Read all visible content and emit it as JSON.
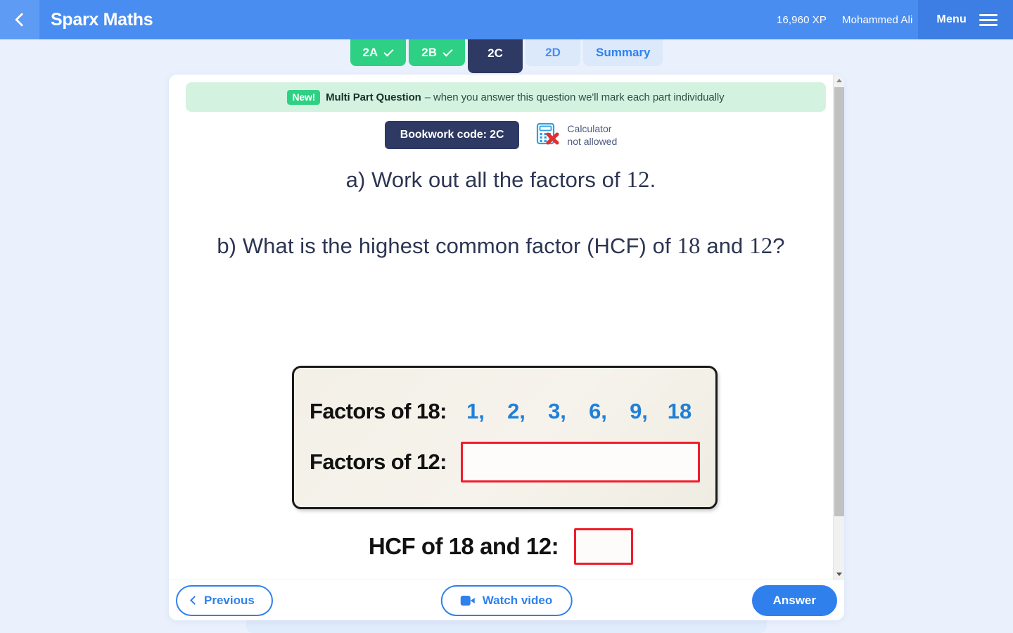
{
  "header": {
    "back_icon": "chevron-left-icon",
    "brand": "Sparx Maths",
    "xp": "16,960 XP",
    "user": "Mohammed Ali",
    "menu_label": "Menu",
    "menu_icon": "hamburger-icon",
    "bg_color": "#4a8df0",
    "menu_bg_color": "#3d7ee4"
  },
  "tabs": [
    {
      "label": "2A",
      "state": "done",
      "tick": true
    },
    {
      "label": "2B",
      "state": "done",
      "tick": true
    },
    {
      "label": "2C",
      "state": "active",
      "tick": false
    },
    {
      "label": "2D",
      "state": "upcoming",
      "tick": false
    },
    {
      "label": "Summary",
      "state": "summary",
      "tick": false
    }
  ],
  "banner": {
    "badge": "New!",
    "title": "Multi Part Question",
    "text": "– when you answer this question we'll mark each part individually",
    "bg_color": "#d4f2e0",
    "badge_color": "#2ed183"
  },
  "meta": {
    "bookwork_code": "Bookwork code: 2C",
    "calculator_icon": "calculator-not-allowed-icon",
    "calculator_line1": "Calculator",
    "calculator_line2": "not allowed"
  },
  "question": {
    "part_a_prefix": "a) Work out all the factors of ",
    "part_a_number": "12",
    "part_a_suffix": ".",
    "part_b_prefix": "b) What is the highest common factor (HCF) of ",
    "part_b_number1": "18",
    "part_b_middle": " and ",
    "part_b_number2": "12",
    "part_b_suffix": "?"
  },
  "diagram": {
    "row1_label": "Factors of 18:",
    "row1_values": [
      "1,",
      "2,",
      "3,",
      "6,",
      "9,",
      "18"
    ],
    "row1_value_color": "#2080d8",
    "row2_label": "Factors of 12:",
    "row2_input_value": "",
    "hcf_label": "HCF of 18 and 12:",
    "hcf_input_value": "",
    "input_border_color": "#f01c2c",
    "box_bg_color": "#f3f0e7"
  },
  "footer": {
    "previous_label": "Previous",
    "previous_icon": "chevron-left-icon",
    "watch_label": "Watch video",
    "watch_icon": "video-camera-icon",
    "answer_label": "Answer",
    "accent_color": "#2f80ed"
  },
  "scrollbar": {
    "up_icon": "triangle-up-icon",
    "down_icon": "triangle-down-icon"
  }
}
